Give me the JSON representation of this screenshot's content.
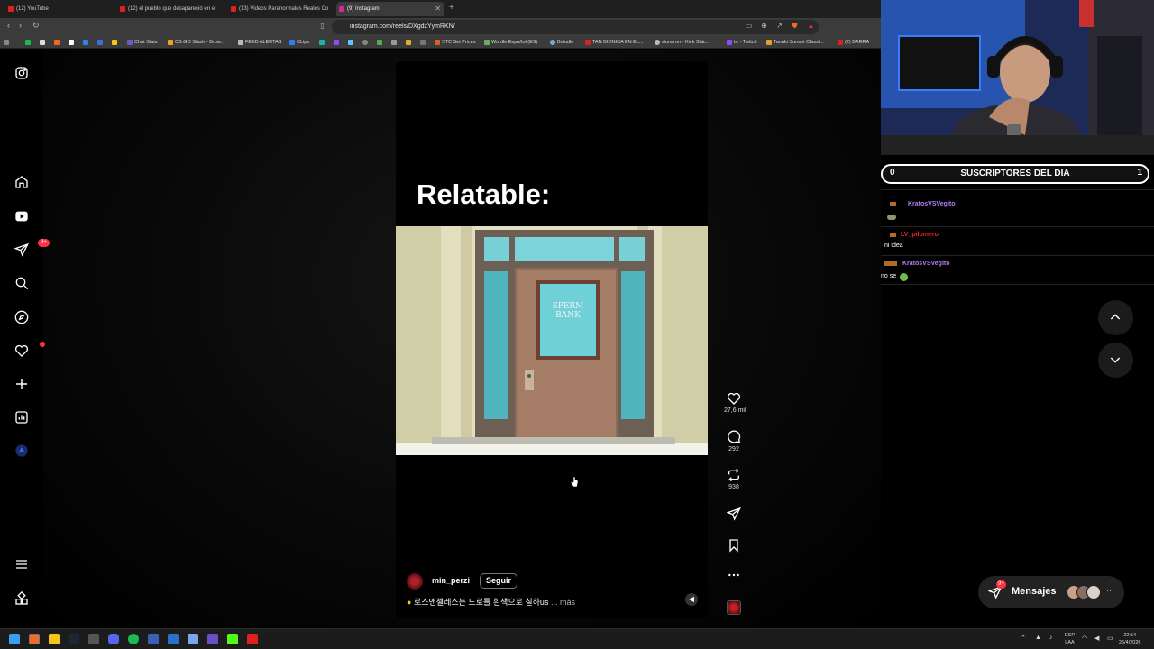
{
  "browser": {
    "tabs": [
      {
        "label": "(12) YouTube"
      },
      {
        "label": "(12) el pueblo que desapareció en el"
      },
      {
        "label": "(13) Videos Paranormales Reales Co"
      },
      {
        "label": "(9) Instagram"
      }
    ],
    "new_tab": "+",
    "url": "instagram.com/reels/DXgdzYymRKN/",
    "bookmarks": [
      "Chat Stats",
      "CS:GO Stash - Brow...",
      "FEED ALERTAS",
      "CLips",
      "STC Set Prices",
      "Wordle Español (ES)",
      "Boludle",
      "TAN BIONICA EN EL...",
      "sionaron - Kick Stat...",
      "trr - Twitch",
      "Tanuki Sunset Classi...",
      "(2) BARRA"
    ]
  },
  "sidebar": {
    "notifications_badge": "9+"
  },
  "reel": {
    "overlay_text": "Relatable:",
    "sign_line1": "SPERM",
    "sign_line2": "BANK",
    "username": "min_perzi",
    "follow_label": "Seguir",
    "caption": "로스앤젤레스는 도로를 흰색으로 칠하us",
    "more_label": "... más"
  },
  "actions": {
    "likes": "27,6 mil",
    "comments": "292",
    "reposts": "938"
  },
  "messages": {
    "label": "Mensajes",
    "badge": "9+"
  },
  "stream": {
    "subs_left": "0",
    "subs_title": "SUSCRIPTORES DEL DIA",
    "subs_right": "1",
    "chat": [
      {
        "user": "KratosVSVegito",
        "msg": "",
        "color": "#b77cf2"
      },
      {
        "user": "LV_pilomero",
        "msg": "ni idea",
        "color": "#e0242c"
      },
      {
        "user": "KratosVSVegito",
        "msg": "no se",
        "color": "#b77cf2"
      }
    ]
  },
  "taskbar": {
    "lang_line1": "ESP",
    "lang_line2": "LAA",
    "time": "22:54",
    "date": "25/4/2026"
  }
}
